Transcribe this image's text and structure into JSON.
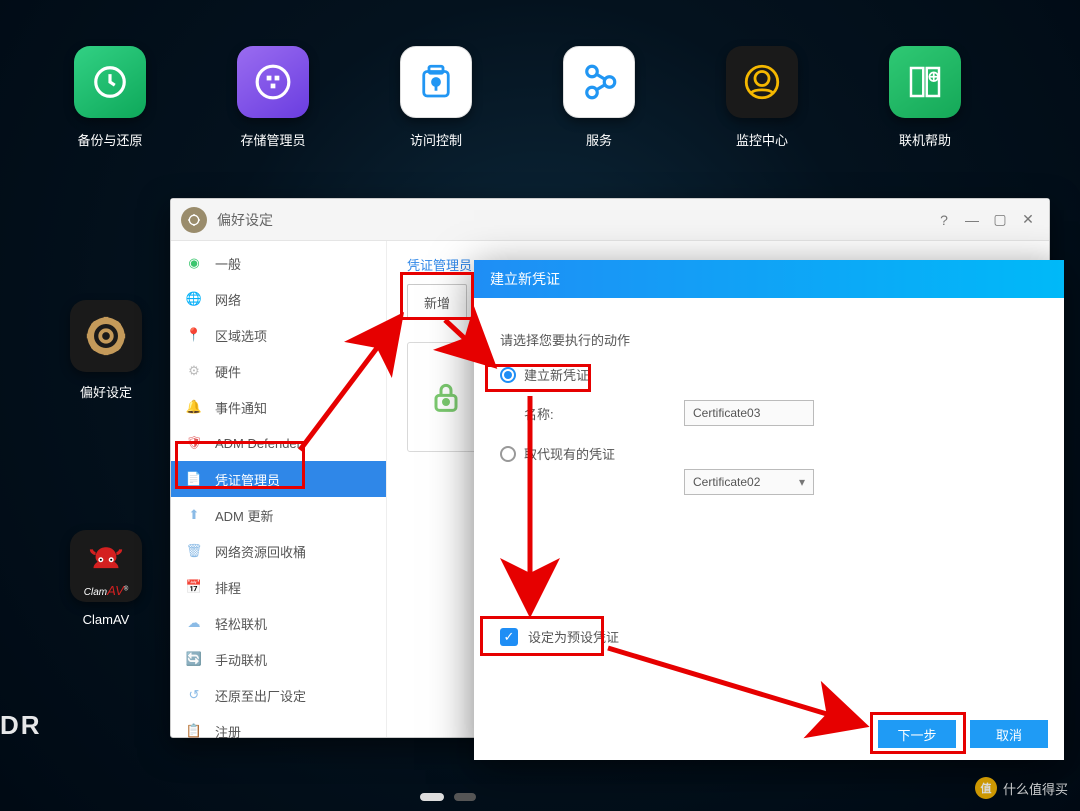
{
  "desktop_row": [
    {
      "label": "备份与还原",
      "color": "tile-backup"
    },
    {
      "label": "存储管理员",
      "color": "tile-storage"
    },
    {
      "label": "访问控制",
      "color": "tile-access"
    },
    {
      "label": "服务",
      "color": "tile-service"
    },
    {
      "label": "监控中心",
      "color": "tile-monitor"
    },
    {
      "label": "联机帮助",
      "color": "tile-help"
    }
  ],
  "side_icons": {
    "pref": "偏好设定",
    "clam": "ClamAV"
  },
  "window": {
    "title": "偏好设定",
    "section_title": "凭证管理员",
    "add_button": "新增",
    "sidebar": [
      "一般",
      "网络",
      "区域选项",
      "硬件",
      "事件通知",
      "ADM Defender",
      "凭证管理员",
      "ADM 更新",
      "网络资源回收桶",
      "排程",
      "轻松联机",
      "手动联机",
      "还原至出厂设定",
      "注册"
    ],
    "active_index": 6
  },
  "modal": {
    "title": "建立新凭证",
    "prompt": "请选择您要执行的动作",
    "opt_create": "建立新凭证",
    "opt_replace": "取代现有的凭证",
    "name_label": "名称:",
    "name_value": "Certificate03",
    "replace_value": "Certificate02",
    "default_chk": "设定为预设凭证",
    "next": "下一步",
    "cancel": "取消"
  },
  "watermark": {
    "badge": "值",
    "text": "什么值得买"
  },
  "brand_fragment": "DR"
}
